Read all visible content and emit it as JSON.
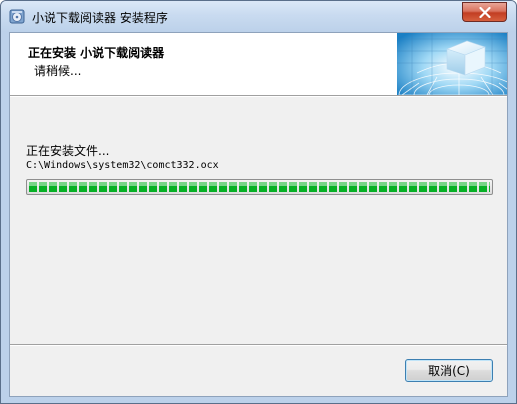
{
  "window": {
    "title": "小说下载阅读器 安装程序"
  },
  "header": {
    "title": "正在安装  小说下载阅读器",
    "subtitle": "请稍候..."
  },
  "main": {
    "status": "正在安装文件...",
    "current_file": "C:\\Windows\\system32\\comct332.ocx",
    "progress_fraction": 1.0
  },
  "footer": {
    "cancel_label": "取消(C)"
  },
  "colors": {
    "progress_green": "#06b025",
    "close_red": "#c23e23"
  },
  "icons": {
    "app": "installer-disc-icon",
    "close": "close-icon",
    "header": "cube-globe-graphic"
  }
}
